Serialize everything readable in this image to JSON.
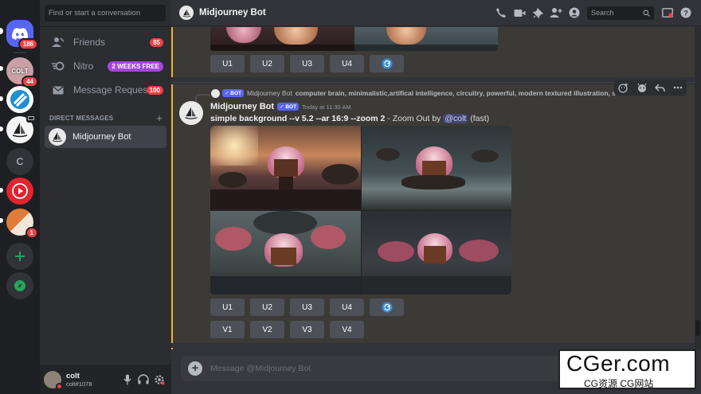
{
  "rail": {
    "home_badge": "186",
    "servers": [
      {
        "label": "COLT",
        "badge": "44"
      },
      {
        "label": "",
        "badge": ""
      },
      {
        "label": "",
        "badge": ""
      },
      {
        "label": "C",
        "badge": ""
      },
      {
        "label": "",
        "badge": ""
      },
      {
        "label": "",
        "badge": "1"
      }
    ]
  },
  "sidebar": {
    "search_placeholder": "Find or start a conversation",
    "nav": [
      {
        "label": "Friends",
        "badge": "85"
      },
      {
        "label": "Nitro",
        "badge": "2 WEEKS FREE"
      },
      {
        "label": "Message Reques...",
        "badge": "100"
      }
    ],
    "dm_header": "DIRECT MESSAGES",
    "dm_add": "+",
    "dm_items": [
      {
        "label": "Midjourney Bot"
      }
    ]
  },
  "user": {
    "name": "colt",
    "tag": "colt#1078"
  },
  "header": {
    "title": "Midjourney Bot",
    "search_placeholder": "Search"
  },
  "upscale_row_top": [
    "U1",
    "U2",
    "U3",
    "U4"
  ],
  "reply": {
    "author": "Midjourney Bot",
    "bot_tag": "BOT",
    "prompt": "computer brain, minimalistic,artifical intelligence, circuitry, powerful, modern textured illustration, so..."
  },
  "message": {
    "author": "Midjourney Bot",
    "bot_tag": "BOT",
    "time": "Today at 11:30 AM",
    "prompt": "simple background --v 5.2 --ar 16:9 --zoom 2",
    "suffix": " - Zoom Out by ",
    "mention": "@colt",
    "mode": " (fast)"
  },
  "buttons": {
    "upscale": [
      "U1",
      "U2",
      "U3",
      "U4"
    ],
    "variation": [
      "V1",
      "V2",
      "V3",
      "V4"
    ]
  },
  "composer": {
    "placeholder": "Message @Midjourney Bot"
  },
  "watermark": {
    "big": "CGer.com",
    "small": "CG资源 CG网站"
  },
  "colors": {
    "rail_bg": "#1e1f22",
    "sidebar_bg": "#2b2d31",
    "chat_bg": "#313338",
    "blurple": "#5865f2",
    "red_badge": "#f23f43",
    "nitro": "#a347db",
    "mention_bar": "#f0b232"
  }
}
